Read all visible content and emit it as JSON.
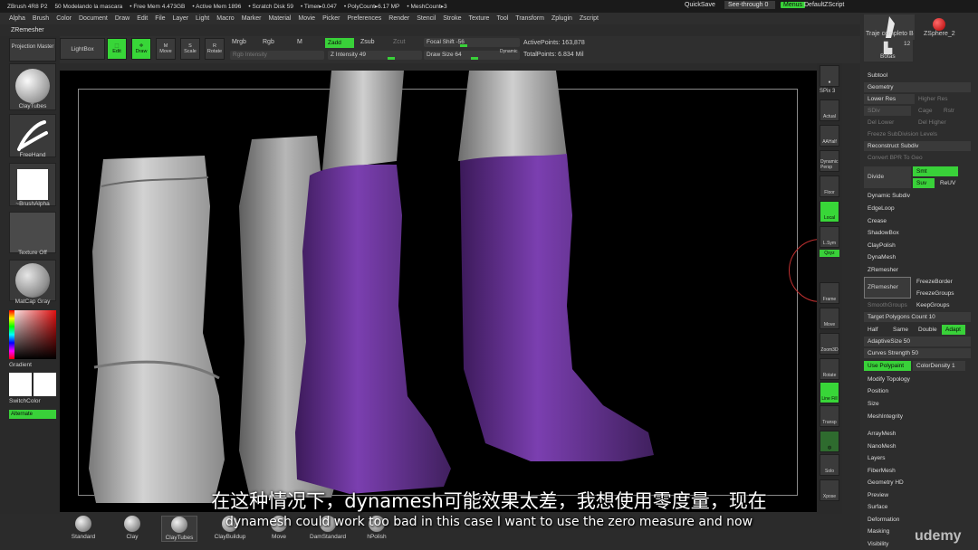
{
  "titlebar": {
    "items": [
      "ZBrush 4R8 P2",
      "50 Modelando la mascara",
      "• Free Mem 4.473GB",
      "• Active Mem 1896",
      "• Scratch Disk 59",
      "• Timer▸0.047",
      "• PolyCount▸6.17 MP",
      "• MeshCount▸3"
    ],
    "quicksave": "QuickSave",
    "see_through": "See-through 0",
    "menus": "Menus",
    "default_zscript": "DefaultZScript"
  },
  "menubar": [
    "Alpha",
    "Brush",
    "Color",
    "Document",
    "Draw",
    "Edit",
    "File",
    "Layer",
    "Light",
    "Macro",
    "Marker",
    "Material",
    "Movie",
    "Picker",
    "Preferences",
    "Render",
    "Stencil",
    "Stroke",
    "Texture",
    "Tool",
    "Transform",
    "Zplugin",
    "Zscript"
  ],
  "palette_title": "ZRemesher",
  "left_tray": {
    "projection_master": "Projection Master",
    "lightbox": "LightBox",
    "brush": "ClayTubes",
    "stroke": "FreeHand",
    "alpha": "~BrushAlpha",
    "texture": "Texture Off",
    "material": "MatCap Gray",
    "gradient": "Gradient",
    "switch_color": "SwitchColor",
    "alternate": "Alternate"
  },
  "top_shelf": {
    "edit": "Edit",
    "draw": "Draw",
    "move": "Move",
    "scale": "Scale",
    "rotate": "Rotate",
    "mrgb": "Mrgb",
    "rgb": "Rgb",
    "m": "M",
    "zadd": "Zadd",
    "zsub": "Zsub",
    "zcut": "Zcut",
    "rgb_intensity": "Rgb Intensity",
    "z_intensity": "Z Intensity 49",
    "focal_shift": "Focal Shift -56",
    "draw_size": "Draw Size 64",
    "dynamic": "Dynamic",
    "active_points": "ActivePoints: 163,878",
    "total_points": "TotalPoints: 6.834 Mil"
  },
  "right_strip": {
    "spix": "SPix 3",
    "actual": "Actual",
    "aahalf": "AAHalf",
    "persp": "Dynamic Persp",
    "floor": "Floor",
    "local": "Local",
    "lsym": "L.Sym",
    "gxyz": "Qxyz",
    "frame": "Frame",
    "move": "Move",
    "zoom3d": "Zoom3D",
    "rotate": "Rotate",
    "linefill": "Line Fill",
    "polyf": "PolyF",
    "transp": "Transp",
    "ghost": "Ghost",
    "solo": "Solo",
    "xpose": "Xpose"
  },
  "right_panel": {
    "tool_a": "Traje completo B",
    "tool_b": "ZSphere_2",
    "tool_c": "Botas",
    "tool_c_count": "12",
    "subtool": "Subtool",
    "geometry": "Geometry",
    "lower_res": "Lower Res",
    "higher_res": "Higher Res",
    "sdiv": "SDiv",
    "cage": "Cage",
    "rstr": "Rstr",
    "del_lower": "Del Lower",
    "del_higher": "Del Higher",
    "freeze_subdiv": "Freeze SubDivision Levels",
    "reconstruct": "Reconstruct Subdiv",
    "convert_bpr": "Convert BPR To Geo",
    "divide": "Divide",
    "smt": "Smt",
    "suv": "Suv",
    "reuv": "ReUV",
    "dynamic_subdiv": "Dynamic Subdiv",
    "edgeloop": "EdgeLoop",
    "crease": "Crease",
    "shadowbox": "ShadowBox",
    "claypolish": "ClayPolish",
    "dynamesh": "DynaMesh",
    "zremesher_header": "ZRemesher",
    "zremesher_btn": "ZRemesher",
    "freezeborder": "FreezeBorder",
    "freezegroups": "FreezeGroups",
    "smoothgroups": "SmoothGroups",
    "keepgroups": "KeepGroups",
    "target_polys": "Target Polygons Count 10",
    "half": "Half",
    "same": "Same",
    "double": "Double",
    "adapt": "Adapt",
    "adaptive_size": "AdaptiveSize 50",
    "curves_strength": "Curves Strength 50",
    "use_polypaint": "Use Polypaint",
    "color_density": "ColorDensity 1",
    "modify_topology": "Modify Topology",
    "position": "Position",
    "size": "Size",
    "meshintegrity": "MeshIntegrity",
    "arraymesh": "ArrayMesh",
    "nanomesh": "NanoMesh",
    "layers": "Layers",
    "fibermesh": "FiberMesh",
    "geometry_hd": "Geometry HD",
    "preview": "Preview",
    "surface": "Surface",
    "deformation": "Deformation",
    "masking": "Masking",
    "visibility": "Visibility"
  },
  "bottom_shelf": [
    "Standard",
    "Clay",
    "ClayTubes",
    "ClayBuildup",
    "Move",
    "DamStandard",
    "hPolish"
  ],
  "subtitles": {
    "zh": "在这种情况下，dynamesh可能效果太差，我想使用零度量，现在",
    "en": "dynamesh could work too bad in this case I want to use the zero measure and now"
  },
  "watermark": "udemy",
  "colors": {
    "accent_green": "#39d139",
    "mesh_purple": "#6a2f9a",
    "boot_gray": "#bdbdbd"
  }
}
